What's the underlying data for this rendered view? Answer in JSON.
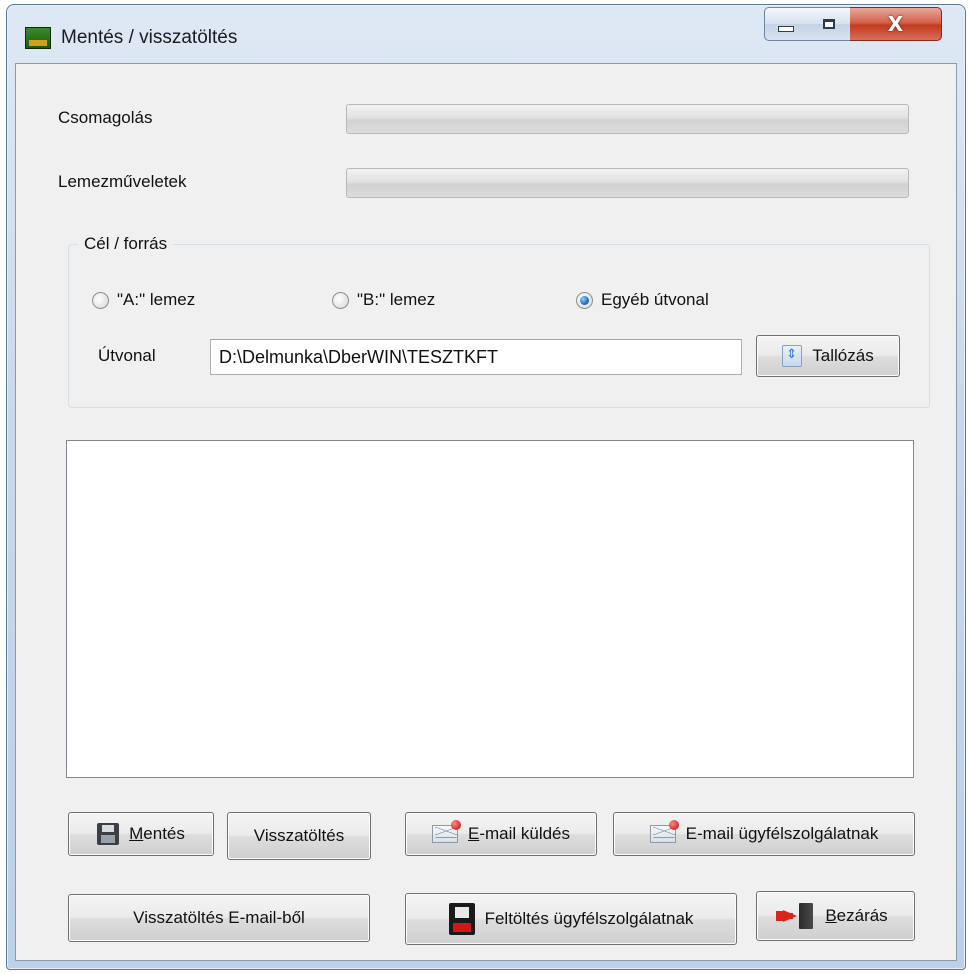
{
  "window": {
    "title": "Mentés / visszatöltés",
    "close_glyph": "X"
  },
  "progress": {
    "packing_label": "Csomagolás",
    "packing_value": 0,
    "disk_label": "Lemezműveletek",
    "disk_value": 0
  },
  "target": {
    "group_title": "Cél / forrás",
    "radio_a": "\"A:\" lemez",
    "radio_b": "\"B:\" lemez",
    "radio_other": "Egyéb útvonal",
    "selected": "other",
    "path_label": "Útvonal",
    "path_value": "D:\\Delmunka\\DberWIN\\TESZTKFT",
    "browse_label": "Tallózás"
  },
  "buttons": {
    "save_key": "M",
    "save_rest": "entés",
    "restore": "Visszatöltés",
    "email_send_key": "E",
    "email_send_rest": "-mail küldés",
    "email_support": "E-mail ügyfélszolgálatnak",
    "restore_email": "Visszatöltés E-mail-ből",
    "upload_support": "Feltöltés ügyfélszolgálatnak",
    "close_key": "B",
    "close_rest": "ezárás"
  },
  "icons": {
    "save": "floppy-icon",
    "email": "mail-icon",
    "upload": "floppy-red-icon",
    "close": "exit-door-icon",
    "browse": "browse-icon"
  }
}
